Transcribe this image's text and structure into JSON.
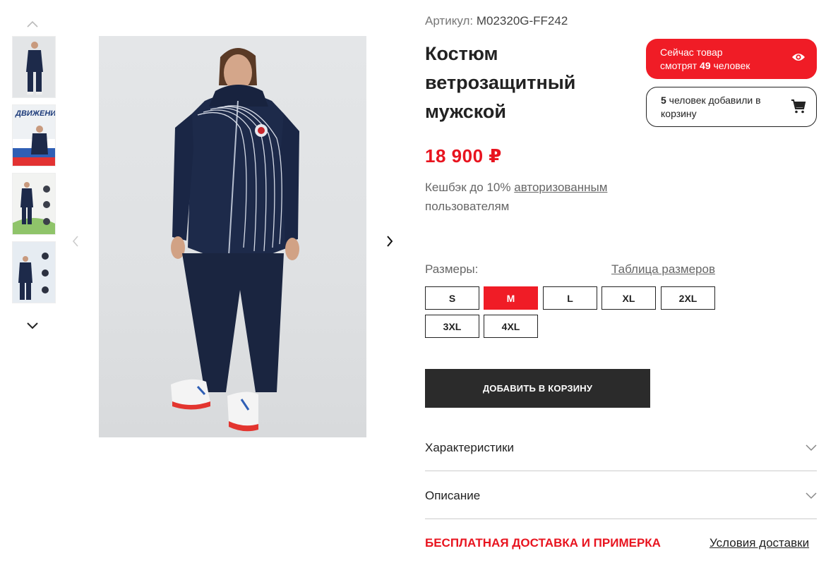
{
  "product": {
    "sku_label": "Артикул:",
    "sku_value": "M02320G-FF242",
    "title": "Костюм ветрозащитный мужской",
    "price": "18 900 ₽",
    "cashback_prefix": "Кешбэк до 10% ",
    "cashback_link": "авторизованным",
    "cashback_suffix": " пользователям"
  },
  "badges": {
    "viewers_line1": "Сейчас товар",
    "viewers_prefix": "смотрят ",
    "viewers_count": "49",
    "viewers_suffix": " человек",
    "cart_count": "5",
    "cart_text": " человек добавили в корзину"
  },
  "thumbnails": [
    {
      "label": ""
    },
    {
      "label": "ДВИЖЕНИЕ"
    },
    {
      "label": ""
    },
    {
      "label": ""
    }
  ],
  "sizes": {
    "label": "Размеры:",
    "table_link": "Таблица размеров",
    "options": [
      "S",
      "M",
      "L",
      "XL",
      "2XL",
      "3XL",
      "4XL"
    ],
    "selected": "M"
  },
  "actions": {
    "add_to_cart": "ДОБАВИТЬ В КОРЗИНУ"
  },
  "accordion": {
    "characteristics": "Характеристики",
    "description": "Описание"
  },
  "delivery": {
    "free": "БЕСПЛАТНАЯ ДОСТАВКА И ПРИМЕРКА",
    "terms": "Условия доставки"
  },
  "colors": {
    "accent": "#f01c26",
    "price": "#e8141f",
    "button_dark": "#2b2b2b",
    "suit_navy": "#1d2a4a"
  },
  "icons": {
    "thumb_up": "chevron-up-icon",
    "thumb_down": "chevron-down-icon",
    "gallery_prev": "chevron-left-icon",
    "gallery_next": "chevron-right-icon",
    "viewers": "eye-icon",
    "cart": "cart-icon",
    "accordion": "chevron-down-icon"
  }
}
